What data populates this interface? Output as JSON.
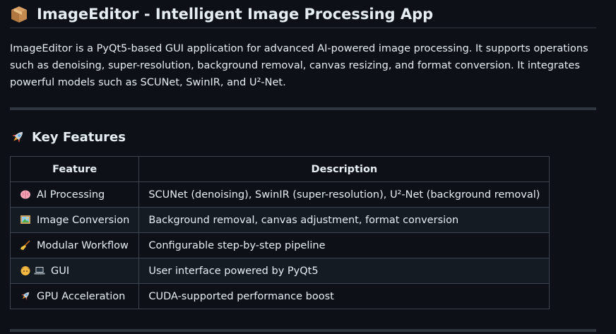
{
  "header": {
    "title": "ImageEditor - Intelligent Image Processing App",
    "icon": "package-box-icon"
  },
  "intro": {
    "text": "ImageEditor is a PyQt5-based GUI application for advanced AI-powered image processing. It supports operations such as denoising, super-resolution, background removal, canvas resizing, and format conversion. It integrates powerful models such as SCUNet, SwinIR, and U²-Net."
  },
  "features_section": {
    "heading": "Key Features",
    "icon": "rocket-icon",
    "table": {
      "headers": [
        "Feature",
        "Description"
      ],
      "rows": [
        {
          "icons": [
            "brain-icon"
          ],
          "feature": "AI Processing",
          "description": "SCUNet (denoising), SwinIR (super-resolution), U²-Net (background removal)"
        },
        {
          "icons": [
            "framed-picture-icon"
          ],
          "feature": "Image Conversion",
          "description": "Background removal, canvas adjustment, format conversion"
        },
        {
          "icons": [
            "broom-icon"
          ],
          "feature": "Modular Workflow",
          "description": "Configurable step-by-step pipeline"
        },
        {
          "icons": [
            "person-icon",
            "laptop-icon"
          ],
          "feature": "GUI",
          "description": "User interface powered by PyQt5"
        },
        {
          "icons": [
            "rocket-icon"
          ],
          "feature": "GPU Acceleration",
          "description": "CUDA-supported performance boost"
        }
      ]
    }
  },
  "colors": {
    "background": "#0d1117",
    "text": "#e6edf3",
    "border": "#3d444d",
    "row_alt": "#151b23",
    "rule": "#30363d"
  }
}
